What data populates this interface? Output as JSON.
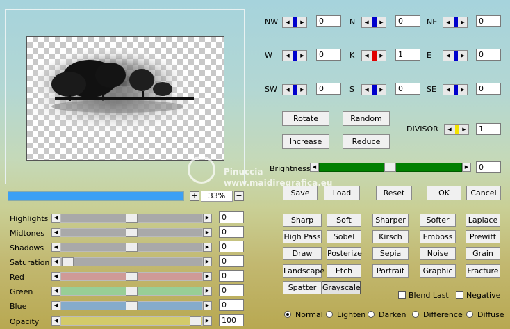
{
  "preview": {
    "zoom_value": "33%",
    "zoom_plus": "+",
    "zoom_minus": "−"
  },
  "watermark": {
    "line1": "Pinuccia",
    "line2": "www.maidiregrafica.eu"
  },
  "sliders": [
    {
      "label": "Highlights",
      "value": "0",
      "level": 0.5,
      "color": "#a9a9a9"
    },
    {
      "label": "Midtones",
      "value": "0",
      "level": 0.5,
      "color": "#a9a9a9"
    },
    {
      "label": "Shadows",
      "value": "0",
      "level": 0.5,
      "color": "#a9a9a9"
    },
    {
      "label": "Saturation",
      "value": "0",
      "level": 0.0,
      "color": "#a9a9a9"
    },
    {
      "label": "Red",
      "value": "0",
      "level": 0.5,
      "color": "#cf9a97"
    },
    {
      "label": "Green",
      "value": "0",
      "level": 0.5,
      "color": "#98ce96"
    },
    {
      "label": "Blue",
      "value": "0",
      "level": 0.5,
      "color": "#85abcb"
    },
    {
      "label": "Opacity",
      "value": "100",
      "level": 1.0,
      "color": "#d3cb6a"
    }
  ],
  "kernel": [
    {
      "label": "NW",
      "value": "0",
      "bar": "#0000cc"
    },
    {
      "label": "N",
      "value": "0",
      "bar": "#0000cc"
    },
    {
      "label": "NE",
      "value": "0",
      "bar": "#0000cc"
    },
    {
      "label": "W",
      "value": "0",
      "bar": "#0000cc"
    },
    {
      "label": "K",
      "value": "1",
      "bar": "#e00000"
    },
    {
      "label": "E",
      "value": "0",
      "bar": "#0000cc"
    },
    {
      "label": "SW",
      "value": "0",
      "bar": "#0000cc"
    },
    {
      "label": "S",
      "value": "0",
      "bar": "#0000cc"
    },
    {
      "label": "SE",
      "value": "0",
      "bar": "#0000cc"
    }
  ],
  "transform_buttons": [
    "Rotate",
    "Random",
    "Increase",
    "Reduce"
  ],
  "divisor": {
    "label": "DIVISOR",
    "value": "1",
    "bar": "#f2e200"
  },
  "brightness": {
    "label": "Brightness",
    "value": "0",
    "level": 0.5,
    "color": "#008000"
  },
  "actions": [
    "Save",
    "Load",
    "Reset",
    "OK",
    "Cancel"
  ],
  "presets": [
    [
      "Sharp",
      "Soft",
      "Sharper",
      "Softer",
      "Laplace"
    ],
    [
      "High Pass",
      "Sobel",
      "Kirsch",
      "Emboss",
      "Prewitt"
    ],
    [
      "Draw",
      "Posterize",
      "Sepia",
      "Noise",
      "Grain"
    ],
    [
      "Landscape",
      "Etch",
      "Portrait",
      "Graphic",
      "Fracture"
    ],
    [
      "Spatter",
      "Grayscale"
    ]
  ],
  "checkboxes": [
    {
      "label": "Blend Last",
      "checked": false
    },
    {
      "label": "Negative",
      "checked": false
    }
  ],
  "blend_modes": [
    {
      "label": "Normal",
      "selected": true
    },
    {
      "label": "Lighten",
      "selected": false
    },
    {
      "label": "Darken",
      "selected": false
    },
    {
      "label": "Difference",
      "selected": false
    },
    {
      "label": "Diffuse",
      "selected": false
    }
  ],
  "arrow_left": "◀",
  "arrow_right": "▶"
}
